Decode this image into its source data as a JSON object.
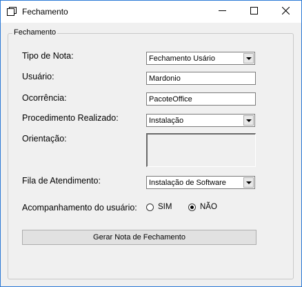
{
  "window": {
    "title": "Fechamento"
  },
  "group": {
    "legend": "Fechamento"
  },
  "form": {
    "tipo_nota": {
      "label": "Tipo de Nota:",
      "value": "Fechamento Usário"
    },
    "usuario": {
      "label": "Usuário:",
      "value": "Mardonio"
    },
    "ocorrencia": {
      "label": "Ocorrência:",
      "value": "PacoteOffice"
    },
    "procedimento": {
      "label": "Procedimento Realizado:",
      "value": "Instalação"
    },
    "orientacao": {
      "label": "Orientação:",
      "value": ""
    },
    "fila": {
      "label": "Fila de Atendimento:",
      "value": "Instalação de Software"
    },
    "acompanhamento": {
      "label": "Acompanhamento do usuário:",
      "options": [
        {
          "label": "SIM",
          "checked": false
        },
        {
          "label": "NÃO",
          "checked": true
        }
      ]
    },
    "submit_label": "Gerar Nota de Fechamento"
  },
  "icons": {
    "app": "window-icon",
    "minimize": "minimize-icon",
    "maximize": "maximize-icon",
    "close": "close-icon"
  }
}
